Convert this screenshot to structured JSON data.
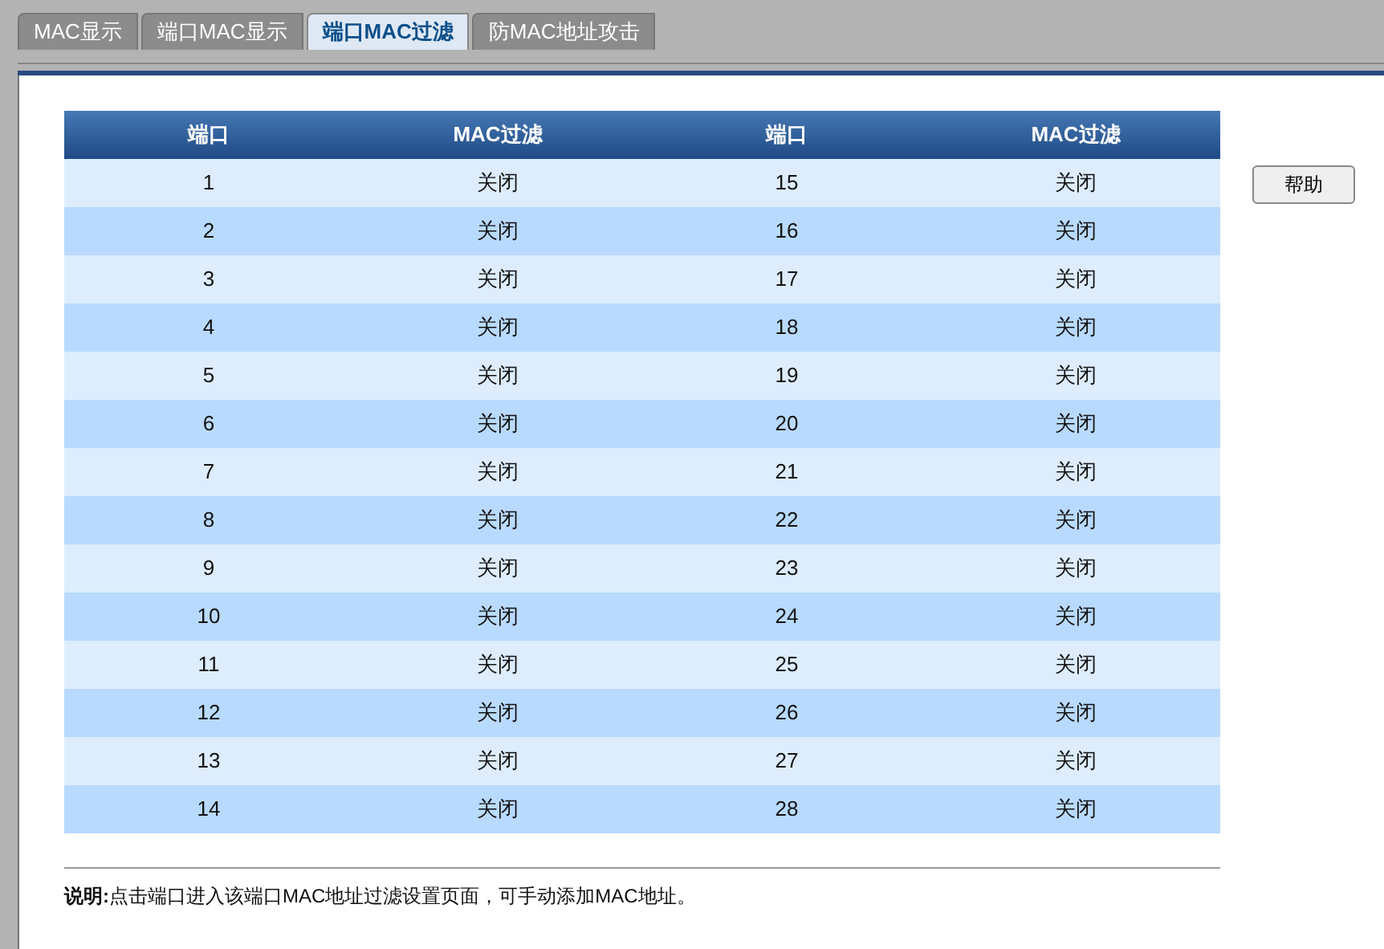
{
  "tabs": [
    {
      "label": "MAC显示",
      "selected": false
    },
    {
      "label": "端口MAC显示",
      "selected": false
    },
    {
      "label": "端口MAC过滤",
      "selected": true
    },
    {
      "label": "防MAC地址攻击",
      "selected": false
    }
  ],
  "table": {
    "columns": [
      "端口",
      "MAC过滤",
      "端口",
      "MAC过滤"
    ],
    "rows": [
      [
        "1",
        "关闭",
        "15",
        "关闭"
      ],
      [
        "2",
        "关闭",
        "16",
        "关闭"
      ],
      [
        "3",
        "关闭",
        "17",
        "关闭"
      ],
      [
        "4",
        "关闭",
        "18",
        "关闭"
      ],
      [
        "5",
        "关闭",
        "19",
        "关闭"
      ],
      [
        "6",
        "关闭",
        "20",
        "关闭"
      ],
      [
        "7",
        "关闭",
        "21",
        "关闭"
      ],
      [
        "8",
        "关闭",
        "22",
        "关闭"
      ],
      [
        "9",
        "关闭",
        "23",
        "关闭"
      ],
      [
        "10",
        "关闭",
        "24",
        "关闭"
      ],
      [
        "11",
        "关闭",
        "25",
        "关闭"
      ],
      [
        "12",
        "关闭",
        "26",
        "关闭"
      ],
      [
        "13",
        "关闭",
        "27",
        "关闭"
      ],
      [
        "14",
        "关闭",
        "28",
        "关闭"
      ]
    ]
  },
  "help_button": "帮助",
  "note": "**说明:**点击端口进入该端口MAC地址过滤设置页面，可手动添加MAC地址。"
}
